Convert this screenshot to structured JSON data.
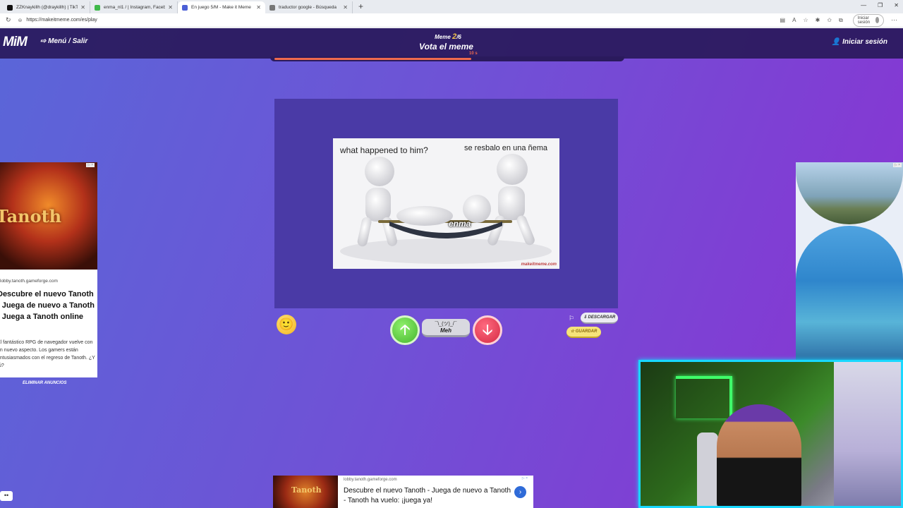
{
  "browser": {
    "tabs": [
      {
        "title": "ZZKnaykillh (@draykillh) | TikTok",
        "color": "#111111"
      },
      {
        "title": "enma_nl1 / | Instagram, Facebook",
        "color": "#3fb94a"
      },
      {
        "title": "En juego 5/M - Make it Meme",
        "color": "#4b5fd6",
        "active": true
      },
      {
        "title": "traductor google - Búsqueda",
        "color": "#777777"
      }
    ],
    "new_tab": "+",
    "url": "https://makeitmeme.com/es/play",
    "signin_label": "Iniciar sesión"
  },
  "header": {
    "logo": "MiM",
    "menu_label": "⇨ Menú / Salir",
    "meme_label": "Meme",
    "meme_current": "2",
    "meme_total": "/6",
    "title": "Vota el meme",
    "timer": "10 s",
    "progress": 0.57,
    "login_label": "Iniciar sesión"
  },
  "meme": {
    "caption_left": "what happened to him?",
    "caption_right": "se resbalo en una ñema",
    "overlay_label": "enma",
    "watermark": "makeitmeme.com"
  },
  "vote": {
    "emoji": "🙂",
    "up_icon": "🡡",
    "meh_shrug": "¯\\_(ツ)_/¯",
    "meh_label": "Meh",
    "down_icon": "🡣",
    "flag_icon": "⚐",
    "download_label": "DESCARGAR",
    "save_label": "GUARDAR"
  },
  "ad_left": {
    "badge": "▷ ×",
    "logo": "Tanoth",
    "domain": "lobby.tanoth.gameforge.com",
    "headline": "Descubre el nuevo Tanoth - Juega de nuevo a Tanoth - Juega a Tanoth online",
    "description": "El fantástico RPG de navegador vuelve con un nuevo aspecto. Los gamers están entusiasmados con el regreso de Tanoth. ¿Y tú?",
    "remove_ads": "ELIMINAR ANUNCIOS"
  },
  "ad_right": {
    "badge": "▷ ×"
  },
  "ad_bottom": {
    "logo": "Tanoth",
    "domain": "lobby.tanoth.gameforge.com",
    "headline": "Descubre el nuevo Tanoth - Juega de nuevo a Tanoth - Tanoth ha vuelo: ¡juega ya!",
    "badge": "▷ ×",
    "go_icon": "›"
  }
}
